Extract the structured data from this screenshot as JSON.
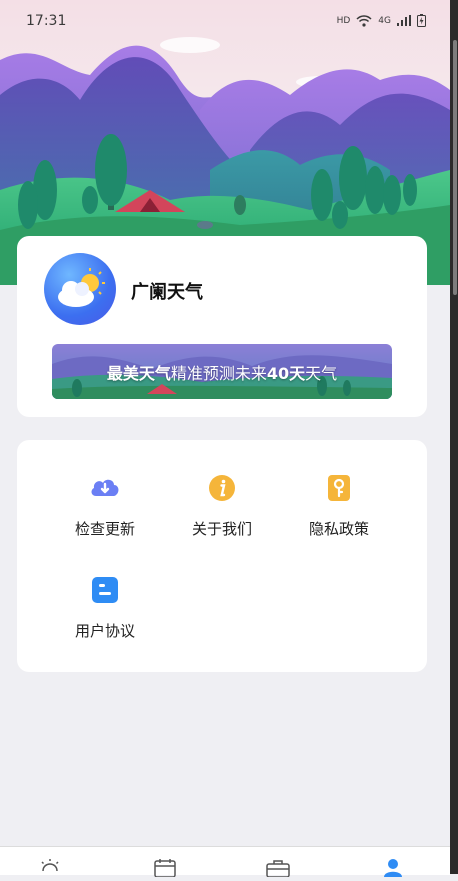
{
  "status_bar": {
    "time": "17:31",
    "hd_label": "HD",
    "network_label": "4G"
  },
  "profile": {
    "app_name": "广阑天气",
    "banner": {
      "part1": "最美天气",
      "part2": "精准预测未来",
      "part3": "40天",
      "part4": "天气"
    }
  },
  "menu": {
    "items": [
      {
        "label": "检查更新",
        "icon": "cloud-download-icon",
        "color": "#6b7ff4"
      },
      {
        "label": "关于我们",
        "icon": "info-icon",
        "color": "#f5b53a"
      },
      {
        "label": "隐私政策",
        "icon": "key-icon",
        "color": "#f5b53a"
      },
      {
        "label": "用户协议",
        "icon": "document-icon",
        "color": "#2f8cf4"
      }
    ]
  },
  "bottom_nav": {
    "items": [
      {
        "icon": "weather-icon",
        "active": false
      },
      {
        "icon": "calendar-icon",
        "active": false
      },
      {
        "icon": "toolbox-icon",
        "active": false
      },
      {
        "icon": "user-icon",
        "active": true
      }
    ],
    "active_color": "#2f8cf4"
  }
}
